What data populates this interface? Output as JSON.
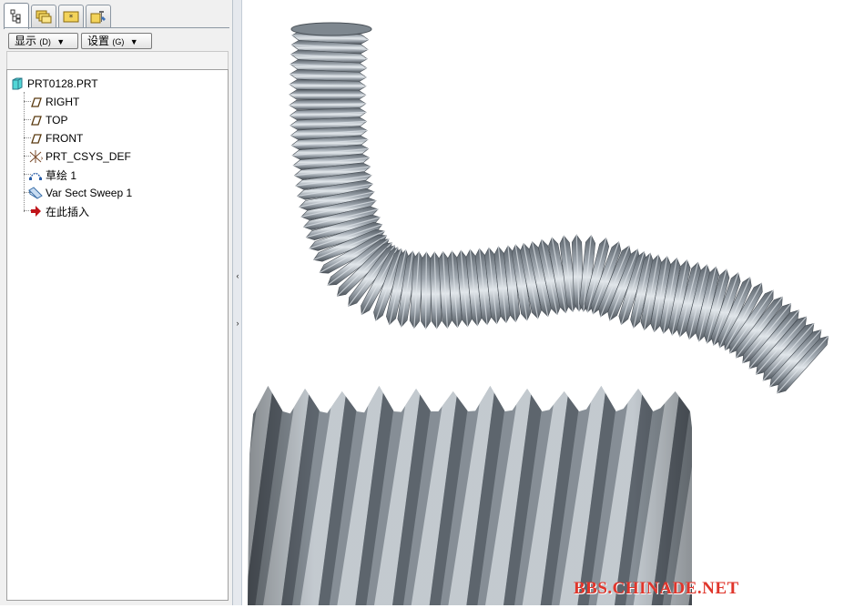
{
  "navigator": {
    "tabs": [
      {
        "name": "model-tree-tab",
        "icon": "model-tree-icon"
      },
      {
        "name": "folder-browser-tab",
        "icon": "folders-icon"
      },
      {
        "name": "favorites-tab",
        "icon": "favorites-folder-icon"
      },
      {
        "name": "connections-tab",
        "icon": "tools-icon"
      }
    ],
    "show_button": {
      "label": "显示",
      "shortcut": "(D)"
    },
    "settings_button": {
      "label": "设置",
      "shortcut": "(G)"
    },
    "tree": {
      "root": "PRT0128.PRT",
      "items": [
        {
          "label": "RIGHT",
          "icon": "datum-plane-icon"
        },
        {
          "label": "TOP",
          "icon": "datum-plane-icon"
        },
        {
          "label": "FRONT",
          "icon": "datum-plane-icon"
        },
        {
          "label": "PRT_CSYS_DEF",
          "icon": "coordinate-system-icon"
        },
        {
          "label": "草绘 1",
          "icon": "sketch-icon"
        },
        {
          "label": "Var Sect Sweep 1",
          "icon": "var-sect-sweep-icon"
        },
        {
          "label": "在此插入",
          "icon": "insert-here-arrow-icon"
        }
      ]
    }
  },
  "splitter": {
    "collapse": "‹",
    "expand": "›"
  },
  "viewport": {
    "models": [
      "corrugated-hose-model",
      "hose-closeup-model"
    ],
    "body_color": "#8d969e",
    "watermark": "BBS.CHINADE.NET",
    "watermark_color": "#e0362c"
  }
}
